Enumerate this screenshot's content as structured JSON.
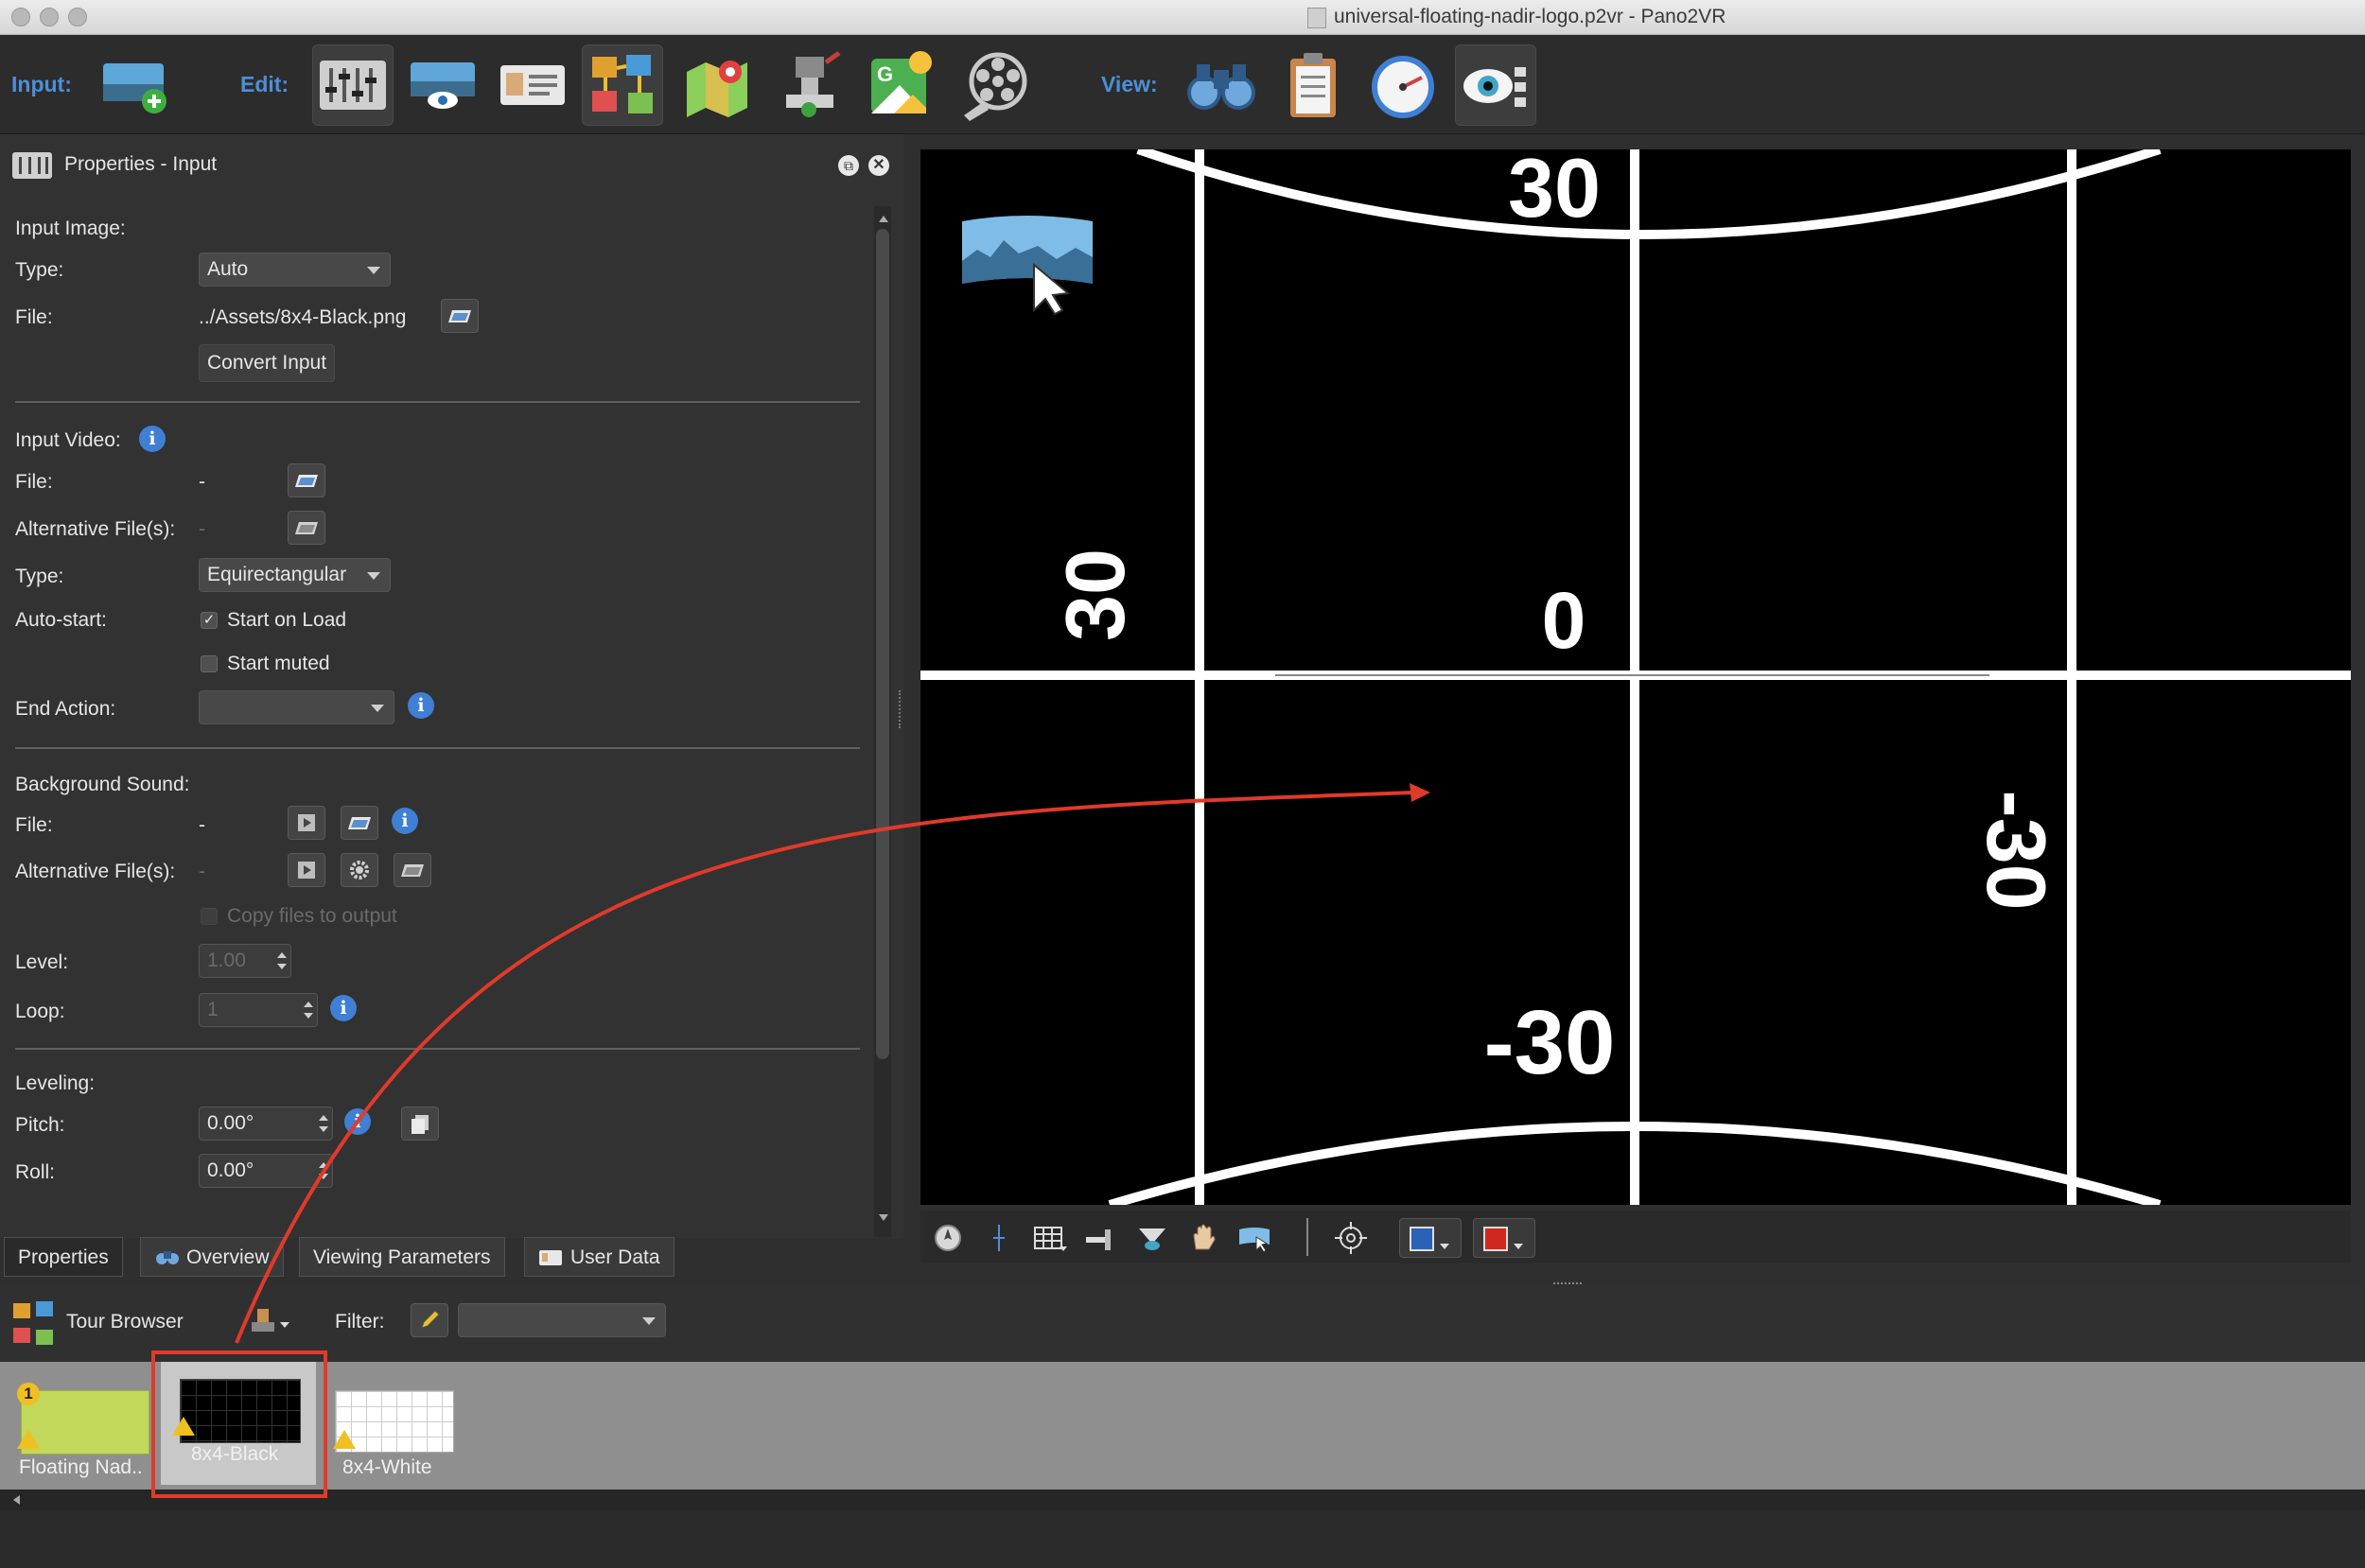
{
  "window": {
    "title": "universal-floating-nadir-logo.p2vr - Pano2VR"
  },
  "toolbar": {
    "input_label": "Input:",
    "edit_label": "Edit:",
    "view_label": "View:"
  },
  "panel": {
    "title": "Properties - Input",
    "input_image": {
      "section": "Input Image:",
      "type_label": "Type:",
      "type_value": "Auto",
      "file_label": "File:",
      "file_value": "../Assets/8x4-Black.png",
      "convert_button": "Convert Input"
    },
    "input_video": {
      "section": "Input Video:",
      "file_label": "File:",
      "file_value": "-",
      "alt_label": "Alternative File(s):",
      "alt_value": "-",
      "type_label": "Type:",
      "type_value": "Equirectangular",
      "autostart_label": "Auto-start:",
      "start_on_load": "Start on Load",
      "start_muted": "Start muted",
      "end_action_label": "End Action:",
      "end_action_value": ""
    },
    "background_sound": {
      "section": "Background Sound:",
      "file_label": "File:",
      "file_value": "-",
      "alt_label": "Alternative File(s):",
      "alt_value": "-",
      "copy_files": "Copy files to output",
      "level_label": "Level:",
      "level_value": "1.00",
      "loop_label": "Loop:",
      "loop_value": "1"
    },
    "leveling": {
      "section": "Leveling:",
      "pitch_label": "Pitch:",
      "pitch_value": "0.00°",
      "roll_label": "Roll:",
      "roll_value": "0.00°"
    }
  },
  "tabs": [
    "Properties",
    "Overview",
    "Viewing Parameters",
    "User Data"
  ],
  "viewer": {
    "grid_labels": {
      "top": "30",
      "left": "30",
      "center": "0",
      "right": "-30",
      "bottom": "-30"
    }
  },
  "tour_browser": {
    "title": "Tour Browser",
    "filter_label": "Filter:",
    "filter_value": "",
    "nodes": [
      {
        "label": "Floating Nad..",
        "badge": "1",
        "selected": false
      },
      {
        "label": "8x4-Black",
        "badge": "",
        "selected": true
      },
      {
        "label": "8x4-White",
        "badge": "",
        "selected": false
      }
    ]
  },
  "colors": {
    "accent_blue": "#4d8fd6",
    "annotation_red": "#e03a2a",
    "panel_bg": "#323232",
    "viewer_bg": "#000000"
  }
}
